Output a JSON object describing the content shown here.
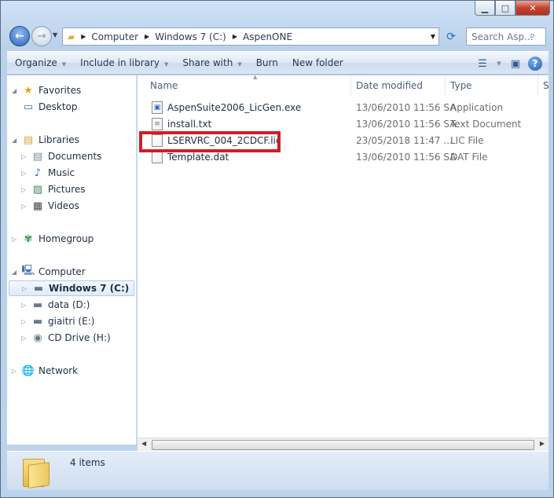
{
  "window": {
    "caption_buttons": {
      "minimize": "▁",
      "maximize": "□",
      "close": "✕"
    }
  },
  "address_bar": {
    "crumbs": [
      "Computer",
      "Windows 7 (C:)",
      "AspenONE"
    ]
  },
  "search": {
    "placeholder": "Search Asp..."
  },
  "toolbar": {
    "organize": "Organize",
    "include_in_library": "Include in library",
    "share_with": "Share with",
    "burn": "Burn",
    "new_folder": "New folder"
  },
  "nav": {
    "favorites": "Favorites",
    "desktop": "Desktop",
    "libraries": "Libraries",
    "documents": "Documents",
    "music": "Music",
    "pictures": "Pictures",
    "videos": "Videos",
    "homegroup": "Homegroup",
    "computer": "Computer",
    "windows7": "Windows 7 (C:)",
    "data": "data (D:)",
    "giaitri": "giaitri (E:)",
    "cddrive": "CD Drive (H:)",
    "network": "Network"
  },
  "columns": {
    "name": "Name",
    "date": "Date modified",
    "type": "Type",
    "size": "S"
  },
  "files": [
    {
      "name": "AspenSuite2006_LicGen.exe",
      "date": "13/06/2010 11:56 SA",
      "type": "Application"
    },
    {
      "name": "install.txt",
      "date": "13/06/2010 11:56 SA",
      "type": "Text Document"
    },
    {
      "name": "LSERVRC_004_2CDCF.lic",
      "date": "23/05/2018 11:47 ...",
      "type": "LIC File"
    },
    {
      "name": "Template.dat",
      "date": "13/06/2010 11:56 SA",
      "type": "DAT File"
    }
  ],
  "status": {
    "count": "4 items"
  },
  "colors": {
    "highlight": "#d11d25",
    "accent": "#2e6bb8"
  }
}
